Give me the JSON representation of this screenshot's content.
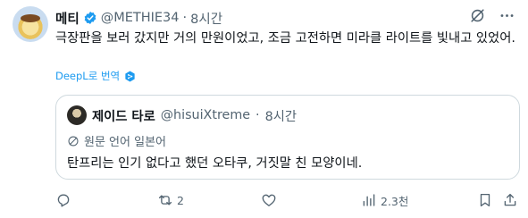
{
  "author": {
    "name": "메티",
    "handle": "@METHIE34",
    "separator": "·",
    "time": "8시간",
    "verified": true
  },
  "tweet": {
    "text": "극장판을 보러 갔지만 거의 만원이었고, 조금 고전하면 미라클 라이트를 빛내고 있었어."
  },
  "translate": {
    "label": "DeepL로 번역"
  },
  "quote": {
    "name": "제이드 타로",
    "handle": "@hisuiXtreme",
    "separator": "·",
    "time": "8시간",
    "language_label": "원문 언어 일본어",
    "text": "탄프리는 인기 없다고 했던 오타쿠, 거짓말 친 모양이네."
  },
  "actions": {
    "reply_count": "",
    "retweet_count": "2",
    "like_count": "",
    "view_count": "2.3천"
  },
  "icons": {
    "verified": "verified-badge-icon",
    "grok": "grok-icon",
    "more": "more-icon",
    "deepl": "deepl-icon",
    "globe": "globe-icon",
    "reply": "reply-icon",
    "retweet": "retweet-icon",
    "like": "like-icon",
    "views": "views-icon",
    "bookmark": "bookmark-icon",
    "share": "share-icon"
  },
  "colors": {
    "accent": "#1d9bf0",
    "muted": "#536471",
    "text": "#0f1419",
    "border": "#cfd9de"
  }
}
